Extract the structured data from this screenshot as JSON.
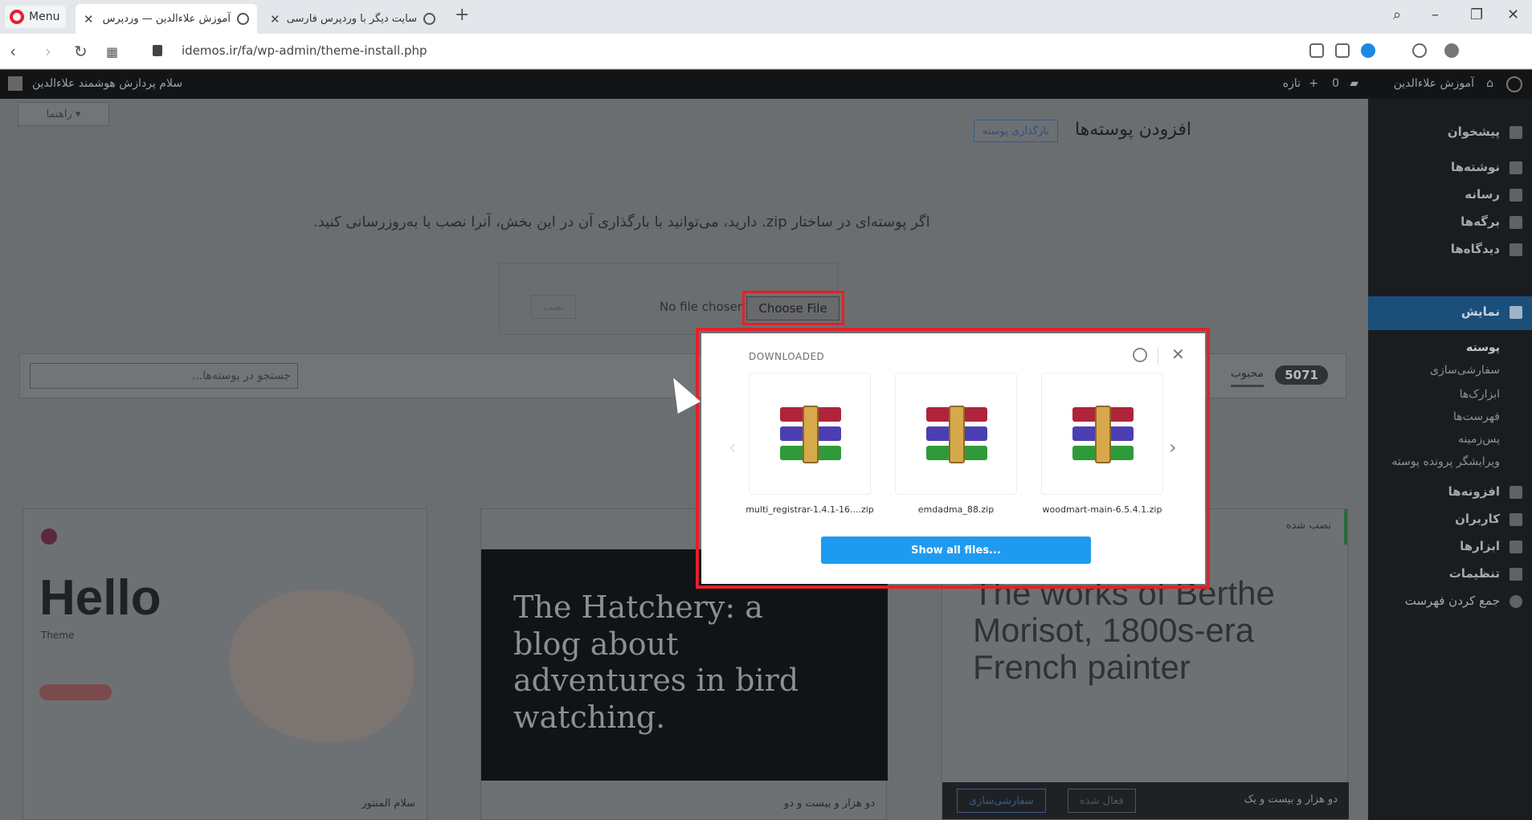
{
  "browser": {
    "menu_label": "Menu",
    "tabs": [
      {
        "title": "آموزش علاءالدین — وردپرس"
      },
      {
        "title": "سایت دیگر با وردپرس فارسی"
      }
    ],
    "new_tab": "+",
    "url": "idemos.ir/fa/wp-admin/theme-install.php"
  },
  "adminbar": {
    "site_name": "آموزش علاءالدین",
    "comments_count": "0",
    "new_label": "تازه",
    "greeting": "سلام پردازش هوشمند علاءالدین"
  },
  "sidebar": {
    "items": [
      {
        "label": "پیشخوان"
      },
      {
        "label": "نوشته‌ها"
      },
      {
        "label": "رسانه"
      },
      {
        "label": "برگه‌ها"
      },
      {
        "label": "دیدگاه‌ها"
      },
      {
        "label": "نمایش"
      },
      {
        "label": "افزونه‌ها"
      },
      {
        "label": "کاربران"
      },
      {
        "label": "ابزارها"
      },
      {
        "label": "تنظیمات"
      },
      {
        "label": "جمع کردن فهرست"
      }
    ],
    "subitems": [
      {
        "label": "پوسته"
      },
      {
        "label": "سفارشی‌سازی"
      },
      {
        "label": "ابزارک‌ها"
      },
      {
        "label": "فهرست‌ها"
      },
      {
        "label": "پس‌زمینه"
      },
      {
        "label": "ویرایشگر پرونده پوسته"
      }
    ]
  },
  "main": {
    "help_label": "راهنما ▾",
    "page_title": "افزودن پوسته‌ها",
    "upload_label": "بارگذاری پوسته",
    "description": "اگر پوسته‌ای در ساختار zip. دارید، می‌توانید با بارگذاری آن در این بخش، آنرا نصب یا به‌روزرسانی کنید.",
    "install_label": "نصب",
    "no_file": "No file chosen",
    "choose_file": "Choose File",
    "search_placeholder": "جستجو در پوسته‌ها...",
    "theme_count": "5071",
    "popular_tab": "محبوب",
    "installed_badge": "نصب شده",
    "cards": [
      {
        "headline": "Hello",
        "sub": "Theme",
        "footer": "سلام المنتور"
      },
      {
        "headline": "The Hatchery: a blog about adventures in bird watching.",
        "footer": "دو هزار و بیست و دو"
      },
      {
        "headline": "The works of Berthe Morisot, 1800s-era French painter",
        "footer": "دو هزار و بیست و یک",
        "btn_customize": "سفارشی‌سازی",
        "btn_active": "فعال شده"
      }
    ]
  },
  "downloads": {
    "title": "DOWNLOADED",
    "files": [
      {
        "name": "multi_registrar-1.4.1-16....zip"
      },
      {
        "name": "emdadma_88.zip"
      },
      {
        "name": "woodmart-main-6.5.4.1.zip"
      }
    ],
    "show_all": "Show all files..."
  }
}
